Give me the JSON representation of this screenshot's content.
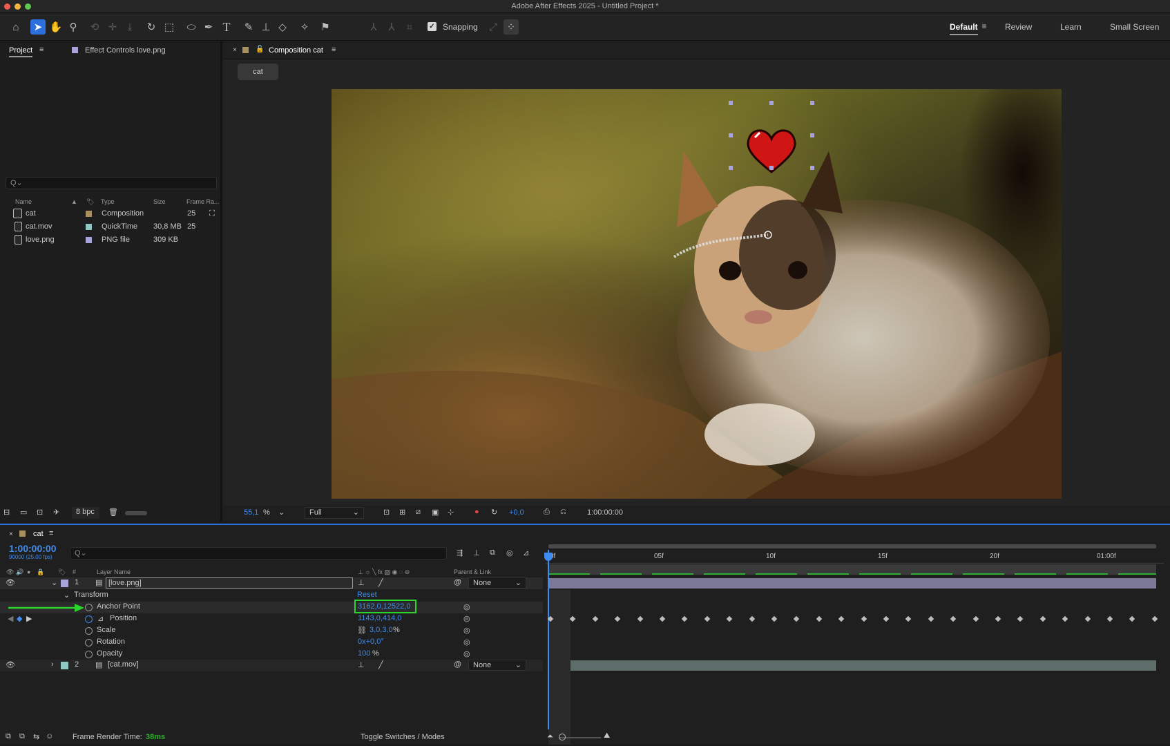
{
  "window": {
    "title": "Adobe After Effects 2025 - Untitled Project *"
  },
  "toolbar": {
    "snapping_label": "Snapping",
    "snapping_checked": true,
    "workspaces": [
      "Default",
      "Review",
      "Learn",
      "Small Screen"
    ],
    "active_workspace": "Default"
  },
  "project_panel": {
    "tab_project": "Project",
    "tab_effect_controls": "Effect Controls love.png",
    "search_placeholder": "Q⌄",
    "columns": [
      "Name",
      "Type",
      "Size",
      "Frame Ra..."
    ],
    "items": [
      {
        "name": "cat",
        "type": "Composition",
        "size": "",
        "frame_rate": "25",
        "label_color": "#a88f5f"
      },
      {
        "name": "cat.mov",
        "type": "QuickTime",
        "size": "30,8 MB",
        "frame_rate": "25",
        "label_color": "#8fc7c0"
      },
      {
        "name": "love.png",
        "type": "PNG file",
        "size": "309 KB",
        "frame_rate": "",
        "label_color": "#a8a3d8"
      }
    ],
    "bpc": "8 bpc"
  },
  "composition_panel": {
    "tab_label": "Composition cat",
    "comp_chip": "cat",
    "zoom": "55,1",
    "zoom_unit": "%",
    "resolution": "Full",
    "exposure": "+0,0",
    "timecode": "1:00:00:00"
  },
  "timeline": {
    "tab_label": "cat",
    "timecode": "1:00:00:00",
    "fps_label": "90000 (25.00 fps)",
    "search_placeholder": "Q⌄",
    "col_hash": "#",
    "col_layer_name": "Layer Name",
    "col_parent": "Parent & Link",
    "ruler_labels": [
      "0f",
      "05f",
      "10f",
      "15f",
      "20f",
      "01:00f"
    ],
    "layers": [
      {
        "index": "1",
        "name": "[love.png]",
        "parent": "None",
        "label_color": "#a8a3d8"
      },
      {
        "index": "2",
        "name": "[cat.mov]",
        "parent": "None",
        "label_color": "#8fc7c0"
      }
    ],
    "transform_label": "Transform",
    "reset_label": "Reset",
    "properties": [
      {
        "name": "Anchor Point",
        "value": "3162,0,12522,0"
      },
      {
        "name": "Position",
        "value": "1143,0,414,0"
      },
      {
        "name": "Scale",
        "value": "3,0,3,0",
        "unit": "%"
      },
      {
        "name": "Rotation",
        "value": "0x+0,0°"
      },
      {
        "name": "Opacity",
        "value": "100",
        "unit": "%"
      }
    ],
    "frame_render_label": "Frame Render Time:",
    "frame_render_value": "38ms",
    "toggle_label": "Toggle Switches / Modes"
  }
}
